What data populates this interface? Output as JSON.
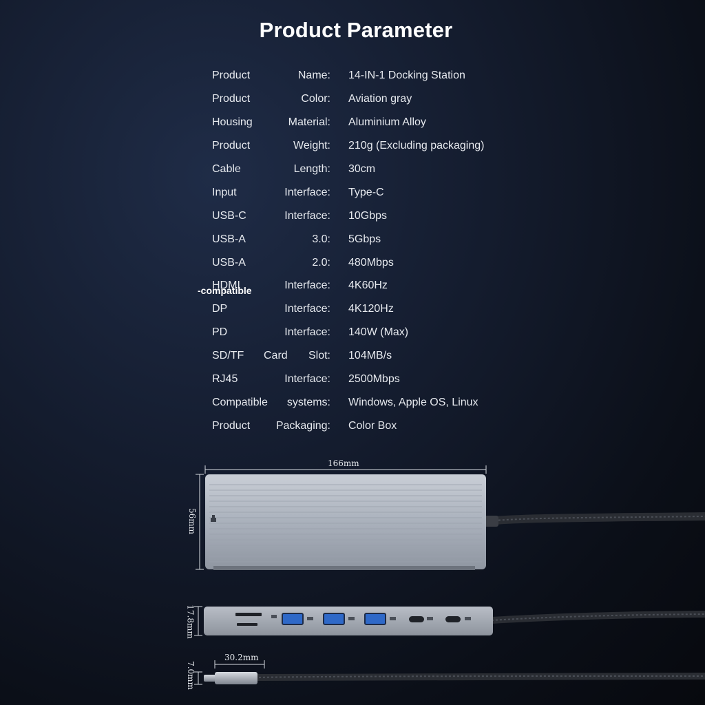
{
  "title": "Product Parameter",
  "specs": [
    {
      "label1": "Product",
      "label2": "Name:",
      "value": "14-IN-1 Docking Station"
    },
    {
      "label1": "Product",
      "label2": "Color:",
      "value": "Aviation gray"
    },
    {
      "label1": "Housing",
      "label2": "Material:",
      "value": "Aluminium Alloy"
    },
    {
      "label1": "Product",
      "label2": "Weight:",
      "value": "210g  (Excluding packaging)"
    },
    {
      "label1": "Cable",
      "label2": "Length:",
      "value": "30cm"
    },
    {
      "label1": "Input",
      "label2": "Interface:",
      "value": "Type-C"
    },
    {
      "label1": "USB-C",
      "label2": "Interface:",
      "value": "10Gbps"
    },
    {
      "label1": "USB-A",
      "label2": "3.0:",
      "value": "5Gbps"
    },
    {
      "label1": "USB-A",
      "label2": "2.0:",
      "value": "480Mbps"
    },
    {
      "label1": "HDMI",
      "label2": "Interface:",
      "value": "4K60Hz"
    },
    {
      "label1": "DP",
      "label2": "Interface:",
      "value": "4K120Hz"
    },
    {
      "label1": "PD",
      "label2": "Interface:",
      "value": "140W (Max)"
    },
    {
      "label1": "SD/TF",
      "label2": "Card",
      "label3": "Slot:",
      "value": "104MB/s"
    },
    {
      "label1": "RJ45",
      "label2": "Interface:",
      "value": "2500Mbps"
    },
    {
      "label1": "Compatible",
      "label2": "systems:",
      "value": "Windows, Apple OS,  Linux"
    },
    {
      "label1": "Product",
      "label2": "Packaging:",
      "value": "Color Box"
    }
  ],
  "hdmi_note": "-compatible",
  "dimensions": {
    "length": "166mm",
    "width": "56mm",
    "thickness": "17.8mm",
    "plug_length": "30.2mm",
    "plug_thickness": "7.0mm"
  }
}
